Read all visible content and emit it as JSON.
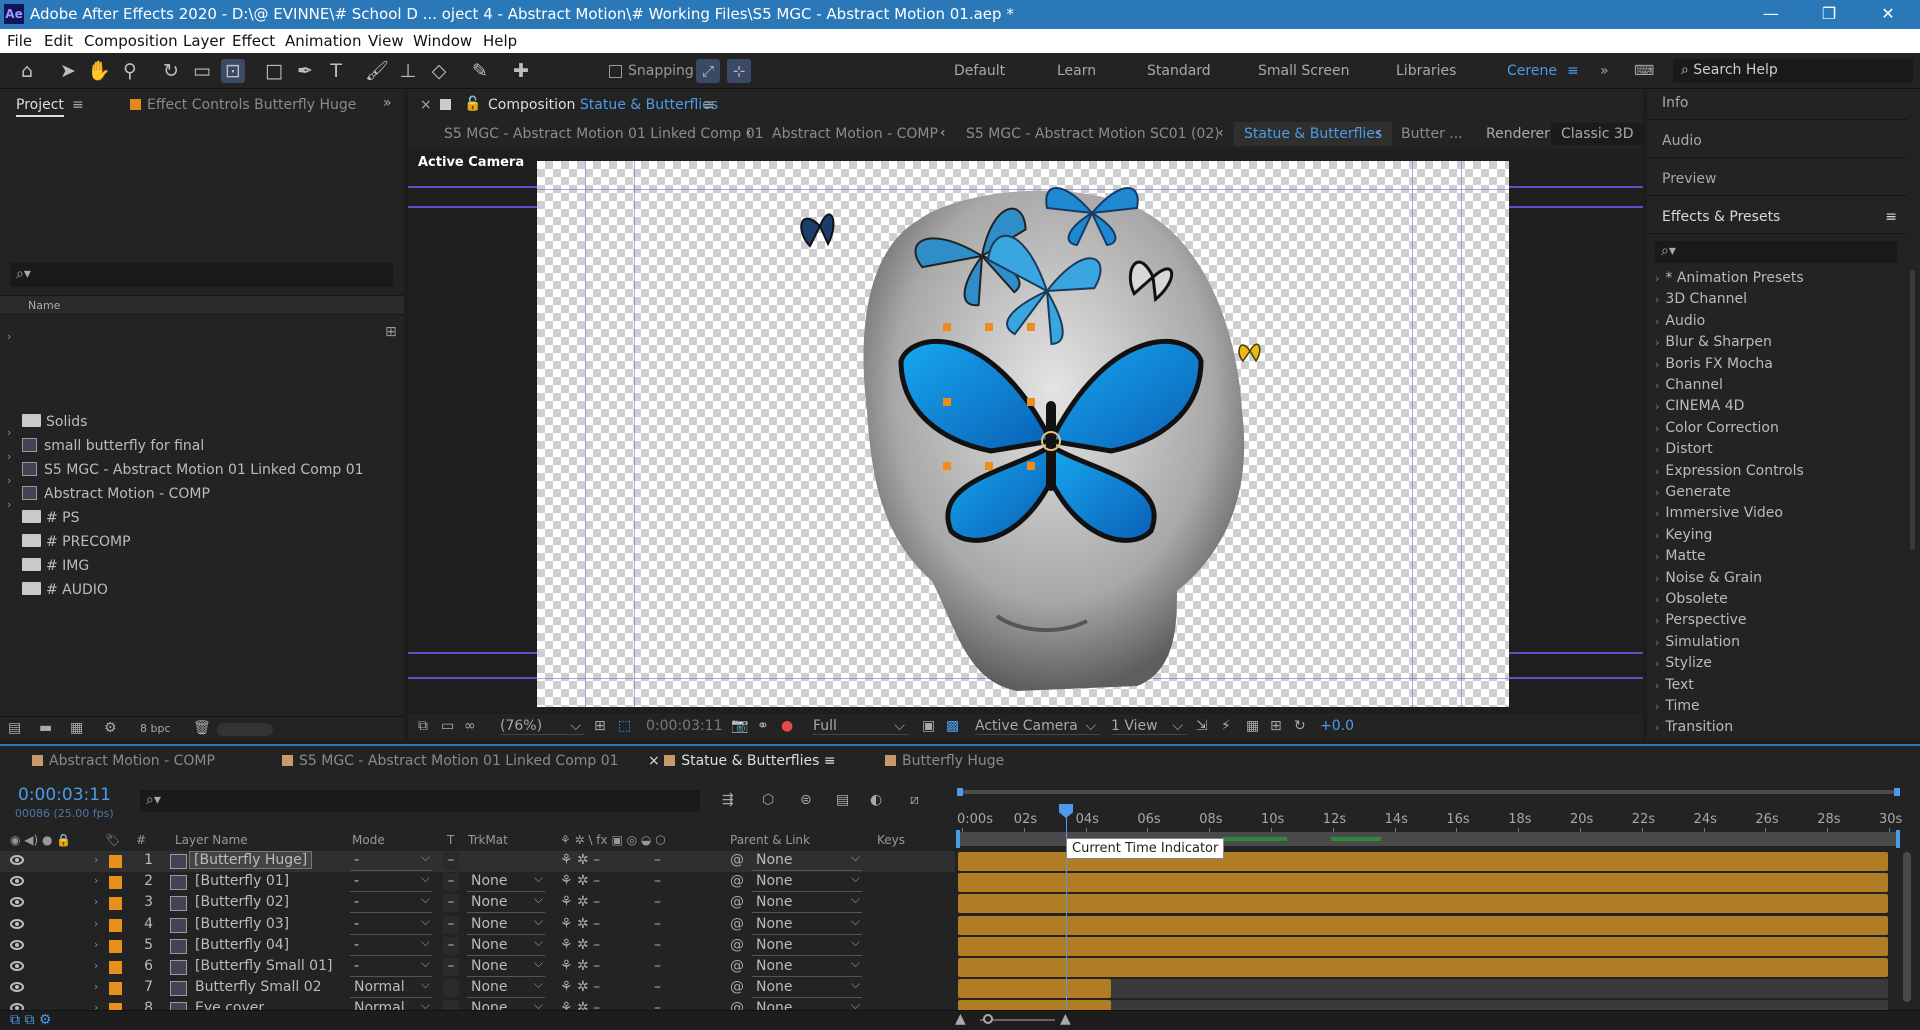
{
  "window": {
    "app_icon": "Ae",
    "title": "Adobe After Effects 2020 - D:\\@ EVINNE\\# School D ... oject 4 - Abstract Motion\\# Working Files\\S5 MGC - Abstract Motion 01.aep *",
    "minimize": "—",
    "restore": "❐",
    "close": "✕"
  },
  "menu": [
    "File",
    "Edit",
    "Composition",
    "Layer",
    "Effect",
    "Animation",
    "View",
    "Window",
    "Help"
  ],
  "toolbar": {
    "snapping": "Snapping",
    "workspaces": [
      "Default",
      "Learn",
      "Standard",
      "Small Screen",
      "Libraries",
      "Cerene"
    ],
    "search_help": "Search Help"
  },
  "project": {
    "tab": "Project",
    "effect_controls_tab": "Effect Controls Butterfly Huge",
    "column_name": "Name",
    "bpc": "8 bpc",
    "items": [
      {
        "type": "folder",
        "label": "Solids"
      },
      {
        "type": "comp",
        "label": "small butterfly for final"
      },
      {
        "type": "comp",
        "label": "S5 MGC - Abstract Motion 01 Linked Comp 01"
      },
      {
        "type": "comp",
        "label": "Abstract Motion - COMP"
      },
      {
        "type": "folder",
        "label": "# PS"
      },
      {
        "type": "folder",
        "label": "# PRECOMP"
      },
      {
        "type": "folder",
        "label": "# IMG"
      },
      {
        "type": "folder",
        "label": "# AUDIO"
      }
    ]
  },
  "composition": {
    "tab_prefix": "Composition",
    "tab_name": "Statue & Butterflies",
    "breadcrumbs": [
      "S5 MGC - Abstract Motion 01 Linked Comp 01",
      "Abstract Motion - COMP",
      "S5 MGC - Abstract Motion SC01 (02)",
      "Statue & Butterflies",
      "Butter ..."
    ],
    "renderer_label": "Renderer:",
    "renderer": "Classic 3D",
    "camera_label": "Active Camera",
    "footer": {
      "zoom": "(76%)",
      "timecode": "0:00:03:11",
      "resolution": "Full",
      "view": "Active Camera",
      "views": "1 View",
      "exposure": "+0.0"
    }
  },
  "right_panels": {
    "tabs": [
      "Info",
      "Audio",
      "Preview"
    ],
    "effects_title": "Effects & Presets",
    "effects": [
      "* Animation Presets",
      "3D Channel",
      "Audio",
      "Blur & Sharpen",
      "Boris FX Mocha",
      "Channel",
      "CINEMA 4D",
      "Color Correction",
      "Distort",
      "Expression Controls",
      "Generate",
      "Immersive Video",
      "Keying",
      "Matte",
      "Noise & Grain",
      "Obsolete",
      "Perspective",
      "Simulation",
      "Stylize",
      "Text",
      "Time",
      "Transition"
    ]
  },
  "timeline": {
    "tabs": [
      "Abstract Motion - COMP",
      "S5 MGC - Abstract Motion 01 Linked Comp 01",
      "Statue & Butterflies",
      "Butterfly Huge"
    ],
    "timecode": "0:00:03:11",
    "frames": "00086 (25.00 fps)",
    "columns": {
      "layer_name": "Layer Name",
      "mode": "Mode",
      "t": "T",
      "trkmat": "TrkMat",
      "parent": "Parent & Link",
      "keys": "Keys",
      "num": "#"
    },
    "ruler": [
      "0:00s",
      "02s",
      "04s",
      "06s",
      "08s",
      "10s",
      "12s",
      "14s",
      "16s",
      "18s",
      "20s",
      "22s",
      "24s",
      "26s",
      "28s",
      "30s"
    ],
    "tooltip": "Current Time Indicator",
    "layers": [
      {
        "num": "1",
        "name": "[Butterfly Huge]",
        "mode": "-",
        "trkmat": "",
        "parent": "None"
      },
      {
        "num": "2",
        "name": "[Butterfly 01]",
        "mode": "-",
        "trkmat": "None",
        "parent": "None"
      },
      {
        "num": "3",
        "name": "[Butterfly 02]",
        "mode": "-",
        "trkmat": "None",
        "parent": "None"
      },
      {
        "num": "4",
        "name": "[Butterfly 03]",
        "mode": "-",
        "trkmat": "None",
        "parent": "None"
      },
      {
        "num": "5",
        "name": "[Butterfly 04]",
        "mode": "-",
        "trkmat": "None",
        "parent": "None"
      },
      {
        "num": "6",
        "name": "[Butterfly Small 01]",
        "mode": "-",
        "trkmat": "None",
        "parent": "None"
      },
      {
        "num": "7",
        "name": "Butterfly Small 02",
        "mode": "Normal",
        "trkmat": "None",
        "parent": "None"
      },
      {
        "num": "8",
        "name": "Eye cover",
        "mode": "Normal",
        "trkmat": "None",
        "parent": "None"
      }
    ]
  },
  "colors": {
    "accent": "#2b78b8",
    "label_orange": "#e8901c",
    "layer_bar": "#b07c24",
    "cti_blue": "#4c9bea"
  }
}
